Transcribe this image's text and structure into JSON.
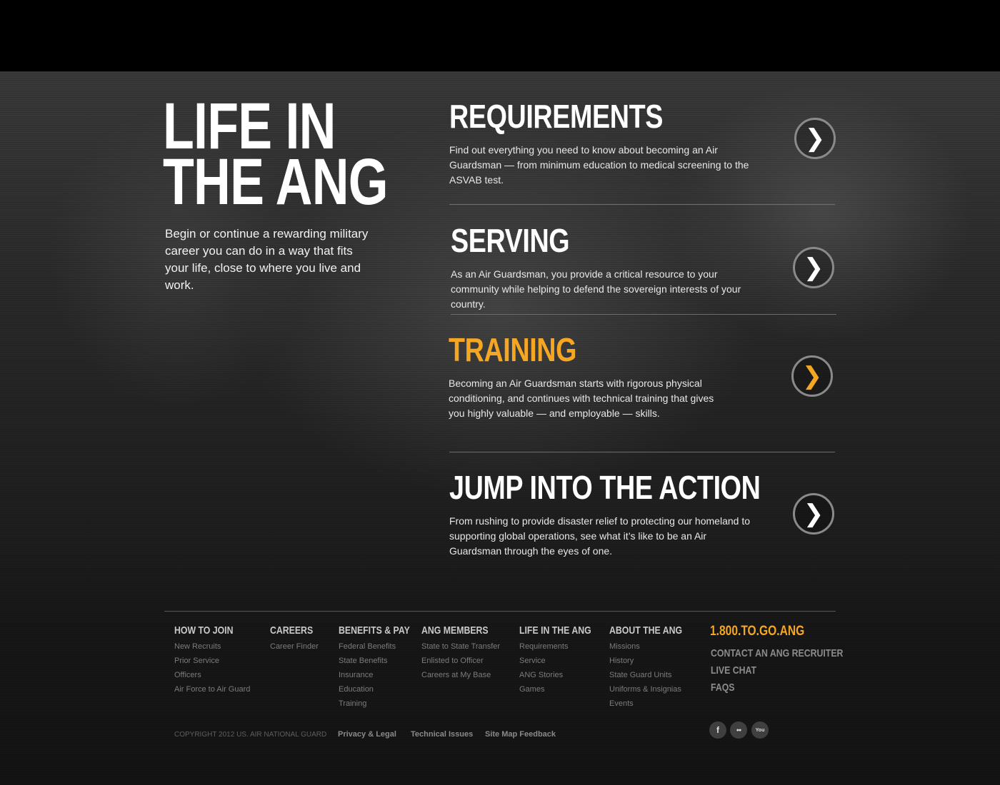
{
  "hero": {
    "title_line1": "LIFE IN",
    "title_line2": "THE ANG",
    "intro": "Begin or continue a rewarding military career you can do in a way that fits your life, close to where you live and work."
  },
  "sections": [
    {
      "title": "REQUIREMENTS",
      "text": "Find out everything you need to know about becoming an Air Guardsman — from minimum education to medical screening to the ASVAB test.",
      "arrow_icon": "chevron-right-icon"
    },
    {
      "title": "SERVING",
      "text": "As an Air Guardsman, you provide a critical resource to your community while helping to defend the sovereign interests of your country.",
      "arrow_icon": "chevron-right-icon"
    },
    {
      "title": "TRAINING",
      "text": "Becoming an Air Guardsman starts with rigorous physical conditioning, and continues with technical training that gives you highly valuable — and employable — skills.",
      "arrow_icon": "chevron-right-icon",
      "active": true
    },
    {
      "title": "JUMP INTO THE ACTION",
      "text": "From rushing to provide disaster relief to protecting our homeland to supporting global operations, see what it’s like to be an Air Guardsman through the eyes of one.",
      "arrow_icon": "chevron-right-icon"
    }
  ],
  "footer": {
    "columns": [
      {
        "head": "HOW TO JOIN",
        "links": [
          "New Recruits",
          "Prior Service",
          "Officers",
          "Air Force to Air Guard"
        ]
      },
      {
        "head": "CAREERS",
        "links": [
          "Career Finder"
        ]
      },
      {
        "head": "BENEFITS & PAY",
        "links": [
          "Federal Benefits",
          "State Benefits",
          "Insurance",
          "Education",
          "Training"
        ]
      },
      {
        "head": "ANG MEMBERS",
        "links": [
          "State to State Transfer",
          "Enlisted to Officer",
          "Careers at My Base"
        ]
      },
      {
        "head": "LIFE IN THE ANG",
        "links": [
          "Requirements",
          "Service",
          "ANG Stories",
          "Games"
        ]
      },
      {
        "head": "ABOUT THE ANG",
        "links": [
          "Missions",
          "History",
          "State Guard Units",
          "Uniforms & Insignias",
          "Events"
        ]
      }
    ],
    "phone": "1.800.TO.GO.ANG",
    "side_links": [
      "CONTACT AN ANG RECRUITER",
      "LIVE CHAT",
      "FAQS"
    ],
    "copyright": "COPYRIGHT 2012 US. AIR NATIONAL GUARD",
    "legal_links": [
      "Privacy & Legal",
      "Technical Issues",
      "Site Map Feedback"
    ],
    "social": [
      {
        "icon": "facebook-icon",
        "glyph": "f"
      },
      {
        "icon": "flickr-icon",
        "glyph": "●●"
      },
      {
        "icon": "youtube-icon",
        "glyph": "You"
      }
    ]
  },
  "colors": {
    "accent": "#f5a623",
    "background": "#161616",
    "topbar": "#000000"
  }
}
